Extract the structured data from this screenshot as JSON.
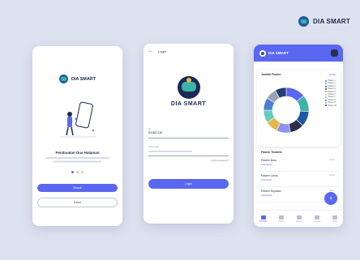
{
  "brand": {
    "name": "DIA SMART"
  },
  "phone1": {
    "logo_text": "DIA SMART",
    "heading": "Pembuatan Dua Halaman",
    "description": "",
    "primary_button": "Masuk",
    "secondary_button": "Daftar"
  },
  "phone2": {
    "title": "Login",
    "logo_text": "DIA SMART",
    "id_label": "ID",
    "id_value": "ID0487135",
    "password_label": "Password",
    "password_placeholder": "",
    "forgot": "Lupa password?",
    "login_button": "Login"
  },
  "phone3": {
    "header_title": "DIA SMART",
    "card_title": "Jumlah Pasien",
    "card_link": "Detail",
    "legend": [
      {
        "label": "Pasien 1",
        "color": "#5a67f0"
      },
      {
        "label": "Pasien 2",
        "color": "#3cb3a6"
      },
      {
        "label": "Pasien 3",
        "color": "#1f5aa6"
      },
      {
        "label": "Pasien 4",
        "color": "#2c2f4a"
      },
      {
        "label": "Pasien 5",
        "color": "#8b93f5"
      },
      {
        "label": "Pasien 6",
        "color": "#e6b84a"
      },
      {
        "label": "Pasien 7",
        "color": "#68cbbf"
      },
      {
        "label": "Pasien 8",
        "color": "#4a7fd0"
      },
      {
        "label": "Pasien 9",
        "color": "#9aa1b3"
      },
      {
        "label": "Pasien 10",
        "color": "#263e78"
      }
    ],
    "section_title": "Pasien Terakhir",
    "list": [
      {
        "title": "Pasien Baru",
        "sub": "Lihat Detail",
        "time": "10.00"
      },
      {
        "title": "Pasien Lama",
        "sub": "Lihat Detail",
        "time": "09.30"
      },
      {
        "title": "Pasien Rujukan",
        "sub": "Lihat Detail",
        "time": "08.15"
      }
    ],
    "fab": "+",
    "nav": [
      "Beranda",
      "Pasien",
      "Jadwal",
      "Laporan",
      "Profil"
    ]
  },
  "chart_data": {
    "type": "pie",
    "categories": [
      "Pasien 1",
      "Pasien 2",
      "Pasien 3",
      "Pasien 4",
      "Pasien 5",
      "Pasien 6",
      "Pasien 7",
      "Pasien 8",
      "Pasien 9",
      "Pasien 10"
    ],
    "values": [
      14,
      12,
      11,
      10,
      10,
      9,
      9,
      9,
      8,
      8
    ],
    "title": "Jumlah Pasien",
    "colors": [
      "#5a67f0",
      "#3cb3a6",
      "#1f5aa6",
      "#2c2f4a",
      "#8b93f5",
      "#e6b84a",
      "#68cbbf",
      "#4a7fd0",
      "#9aa1b3",
      "#263e78"
    ]
  }
}
